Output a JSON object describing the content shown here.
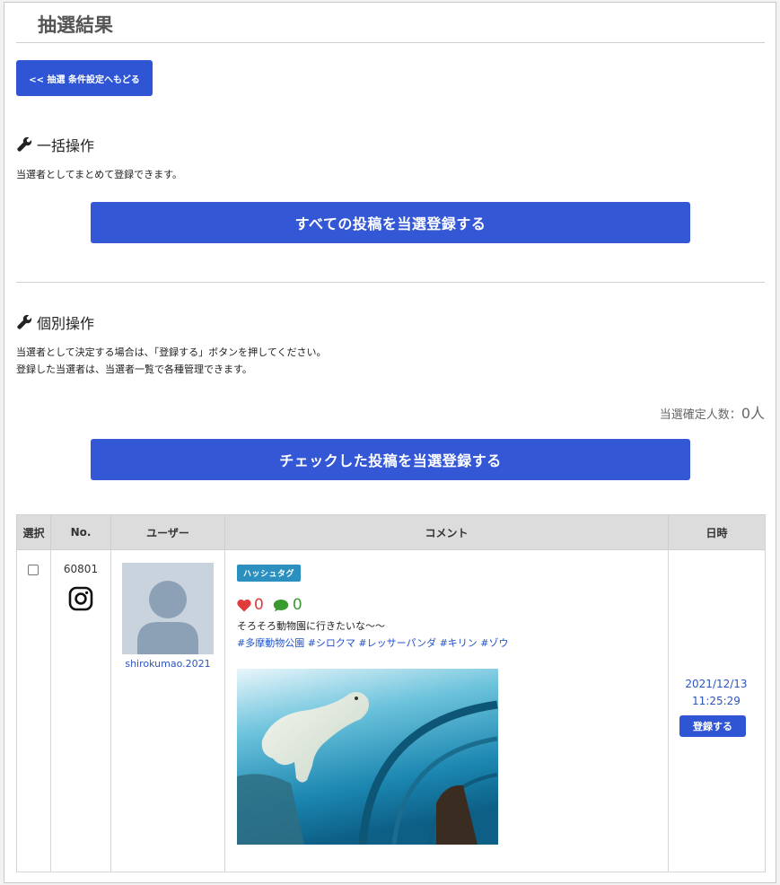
{
  "page": {
    "title": "抽選結果",
    "back_button": "<< 抽選 条件設定へもどる"
  },
  "bulk": {
    "heading": "一括操作",
    "description": "当選者としてまとめて登録できます。",
    "button": "すべての投稿を当選登録する"
  },
  "individual": {
    "heading": "個別操作",
    "description_line1": "当選者として決定する場合は、「登録する」ボタンを押してください。",
    "description_line2": "登録した当選者は、当選者一覧で各種管理できます。",
    "count_label": "当選確定人数：",
    "count_value": "0人",
    "button": "チェックした投稿を当選登録する"
  },
  "table": {
    "headers": [
      "選択",
      "No.",
      "ユーザー",
      "コメント",
      "日時"
    ],
    "rows": [
      {
        "checked": false,
        "number": "60801",
        "platform_icon": "instagram-icon",
        "username": "shirokumao.2021",
        "tag": "ハッシュタグ",
        "likes": "0",
        "comments": "0",
        "text": "そろそろ動物園に行きたいな〜〜",
        "hashtags": "#多摩動物公園 #シロクマ #レッサーパンダ #キリン #ゾウ",
        "date": "2021/12/13",
        "time": "11:25:29",
        "register_button": "登録する"
      }
    ]
  },
  "colors": {
    "primary": "#3457d5",
    "tag": "#2b8fbf",
    "link": "#2a55c0",
    "heart": "#e03a3a",
    "comment": "#3a9a2f"
  }
}
